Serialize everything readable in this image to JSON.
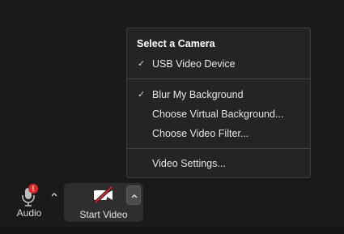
{
  "menu": {
    "header": "Select a Camera",
    "items": [
      {
        "label": "USB Video Device",
        "checked": true
      },
      {
        "label": "Blur My Background",
        "checked": true
      },
      {
        "label": "Choose Virtual Background...",
        "checked": false
      },
      {
        "label": "Choose Video Filter...",
        "checked": false
      },
      {
        "label": "Video Settings...",
        "checked": false
      }
    ],
    "check_glyph": "✓"
  },
  "toolbar": {
    "audio_label": "Audio",
    "audio_badge": "!",
    "video_label": "Start Video",
    "audio_icon": "microphone-icon",
    "video_icon": "camera-off-icon"
  },
  "colors": {
    "background": "#1a1a1a",
    "menu_bg": "#242424",
    "badge_red": "#e02828",
    "camera_slash_red": "#e02828"
  }
}
